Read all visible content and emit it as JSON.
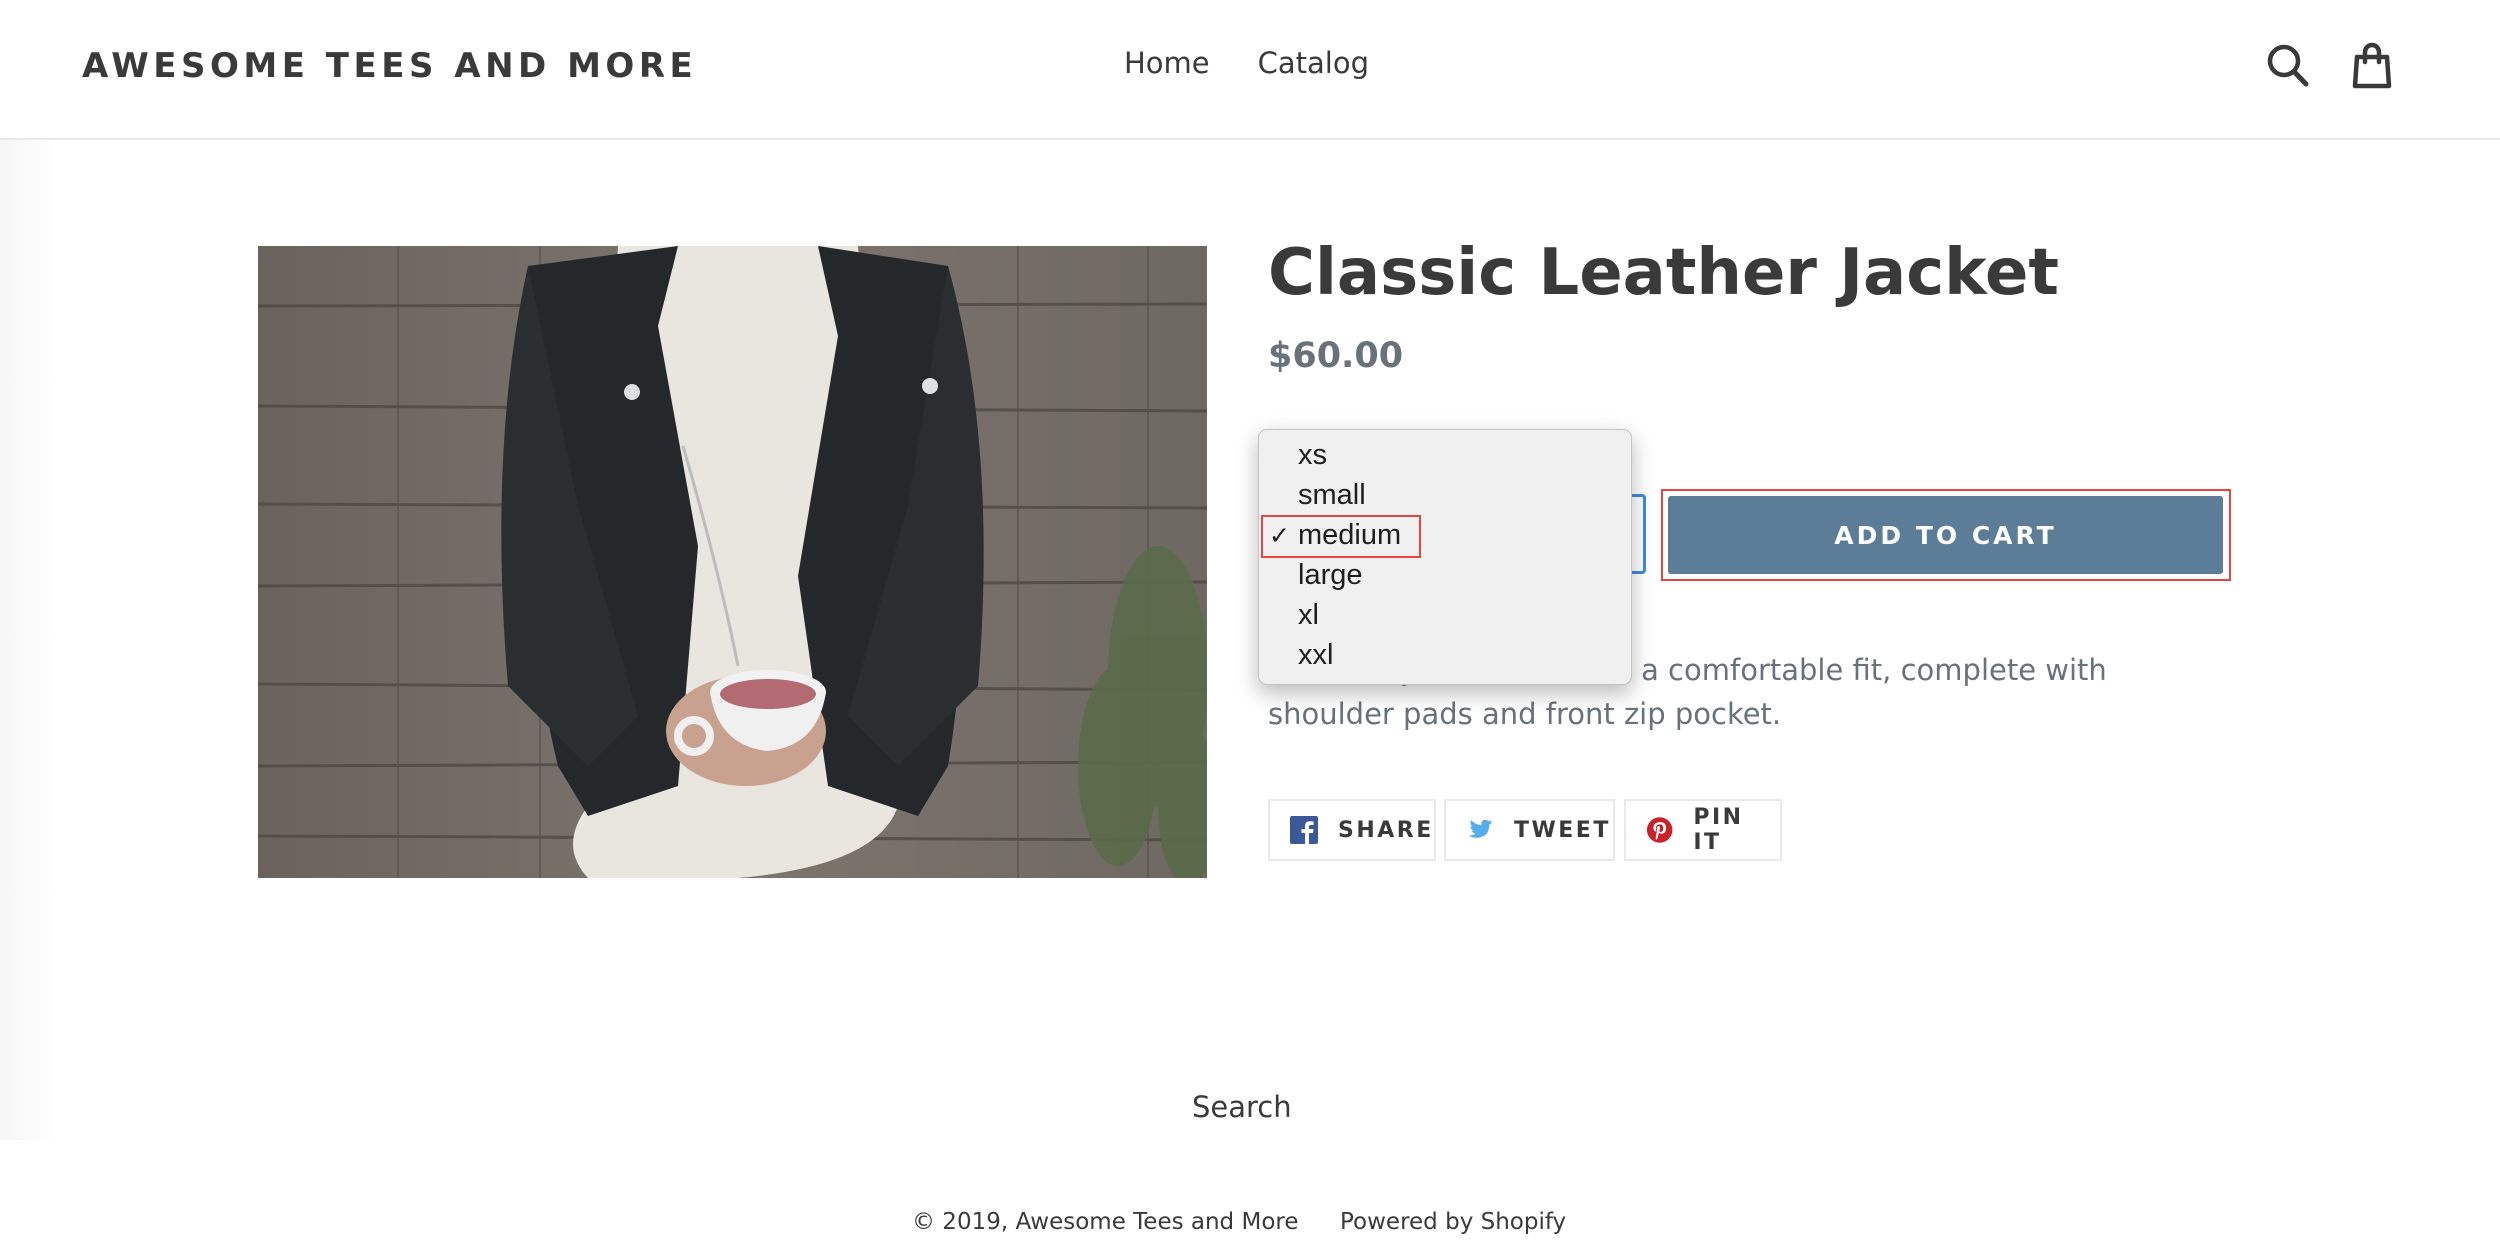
{
  "header": {
    "logo": "AWESOME TEES AND MORE",
    "nav": [
      "Home",
      "Catalog"
    ]
  },
  "product": {
    "image_alt": "Classic Leather Jacket",
    "title": "Classic Leather Jacket",
    "price": "$60.00",
    "size_select": {
      "selected": "medium",
      "options": [
        "xs",
        "small",
        "medium",
        "large",
        "xl",
        "xxl"
      ]
    },
    "add_to_cart": "ADD TO CART",
    "description_visible": "acket. Adjustable belt for a comfortable fit, complete with shoulder pads and front zip pocket."
  },
  "share": {
    "facebook": "SHARE",
    "twitter": "TWEET",
    "pinterest": "PIN IT"
  },
  "footer": {
    "search_link": "Search",
    "copyright": "© 2019, Awesome Tees and More",
    "powered": "Powered by Shopify"
  },
  "colors": {
    "accent_button": "#5c7d97",
    "text_dark": "#3a3a3a",
    "text_muted": "#69727b",
    "highlight_outline": "#e8453c",
    "focus_ring": "#3d8ae6",
    "facebook": "#3b5998",
    "twitter": "#55acee",
    "pinterest": "#cb2027"
  },
  "icons": {
    "search": "search-icon",
    "cart": "shopping-bag-icon",
    "facebook": "facebook-icon",
    "twitter": "twitter-icon",
    "pinterest": "pinterest-icon",
    "check": "checkmark-icon"
  }
}
